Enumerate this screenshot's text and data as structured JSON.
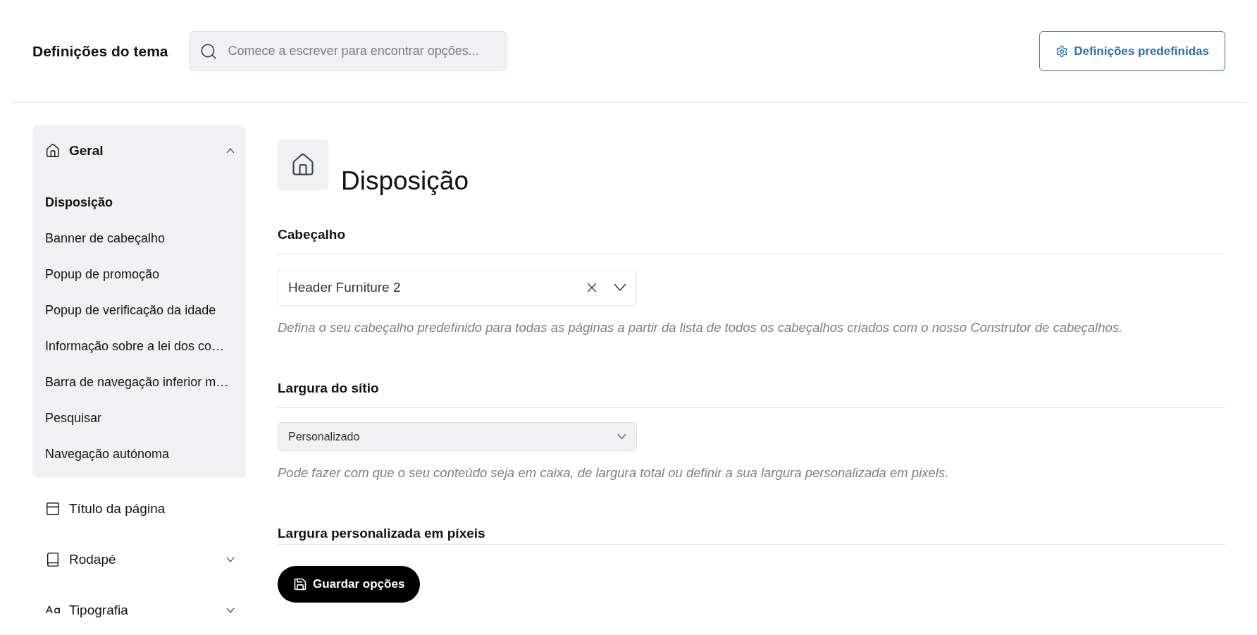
{
  "header": {
    "title": "Definições do tema",
    "search": {
      "placeholder": "Comece a escrever para encontrar opções..."
    },
    "presets_button": "Definições predefinidas"
  },
  "sidebar": {
    "sections": [
      {
        "label": "Geral",
        "expanded": true,
        "children": [
          {
            "label": "Disposição",
            "selected": true
          },
          {
            "label": "Banner de cabeçalho",
            "selected": false
          },
          {
            "label": "Popup de promoção",
            "selected": false
          },
          {
            "label": "Popup de verificação da idade",
            "selected": false
          },
          {
            "label": "Informação sobre a lei dos co…",
            "selected": false
          },
          {
            "label": "Barra de navegação inferior m…",
            "selected": false
          },
          {
            "label": "Pesquisar",
            "selected": false
          },
          {
            "label": "Navegação autónoma",
            "selected": false
          }
        ]
      },
      {
        "label": "Título da página"
      },
      {
        "label": "Rodapé",
        "expanded": false
      },
      {
        "label": "Tipografia",
        "expanded": false
      }
    ]
  },
  "page": {
    "title": "Disposição",
    "fields": [
      {
        "kind": "clearable-select",
        "label": "Cabeçalho",
        "value": "Header Furniture 2",
        "description": "Defina o seu cabeçalho predefinido para todas as páginas a partir da lista de todos os cabeçalhos criados com o nosso Construtor de cabeçalhos."
      },
      {
        "kind": "select",
        "label": "Largura do sítio",
        "value": "Personalizado",
        "description": "Pode fazer com que o seu conteúdo seja em caixa, de largura total ou definir a sua largura personalizada em pixels."
      },
      {
        "kind": "heading",
        "label": "Largura personalizada em píxeis"
      }
    ]
  },
  "save_button": "Guardar opções"
}
